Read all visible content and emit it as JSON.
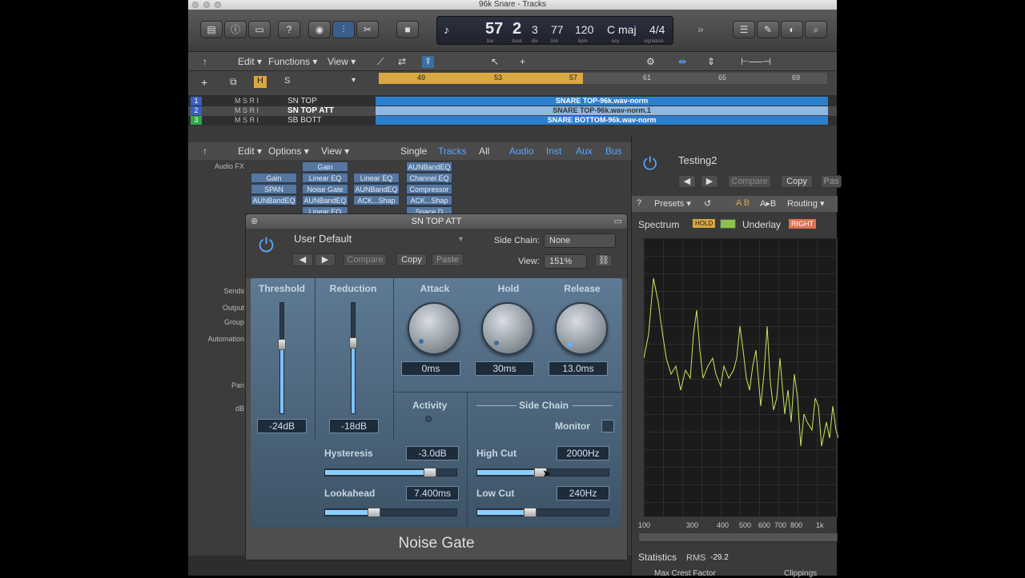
{
  "window": {
    "title": "96k Snare - Tracks"
  },
  "lcd": {
    "bar": "57",
    "beat": "2",
    "div": "3",
    "tick": "77",
    "tempo": "120",
    "key": "C maj",
    "signature": "4/4",
    "bar_label": "bar",
    "beat_label": "beat",
    "div_label": "div",
    "tick_label": "tick",
    "tempo_label": "bpm",
    "key_label": "key",
    "sig_label": "signature"
  },
  "toolbar_more": "»",
  "menubar": {
    "edit": "Edit ▾",
    "functions": "Functions ▾",
    "view": "View ▾"
  },
  "track_header": {
    "h_label": "H",
    "s_label": "S"
  },
  "ruler": {
    "marks": [
      "49",
      "53",
      "57",
      "61",
      "65",
      "69"
    ]
  },
  "tracks": [
    {
      "num": "1",
      "name": "SN TOP",
      "region": "SNARE TOP-96k.wav-norm"
    },
    {
      "num": "2",
      "name": "SN TOP ATT",
      "region": "SNARE TOP-96k.wav-norm.1"
    },
    {
      "num": "3",
      "name": "SB BOTT",
      "region": "SNARE BOTTOM-96k.wav-norm"
    }
  ],
  "mixer": {
    "edit": "Edit ▾",
    "options": "Options ▾",
    "view": "View ▾",
    "filters": {
      "single": "Single",
      "tracks": "Tracks",
      "all": "All",
      "audio": "Audio",
      "inst": "Inst",
      "aux": "Aux",
      "bus": "Bus"
    },
    "audio_fx_label": "Audio FX",
    "labels": {
      "sends": "Sends",
      "output": "Output",
      "group": "Group",
      "automation": "Automation",
      "pan": "Pan",
      "db": "dB"
    },
    "strip1": [
      "Gain",
      "SPAN",
      "AUNBandEQ"
    ],
    "strip2": [
      "Gain",
      "Linear EQ",
      "Noise Gate",
      "AUNBandEQ",
      "Linear EQ"
    ],
    "strip3": [
      "Linear EQ",
      "AUNBandEQ",
      "ACK...Shap"
    ],
    "strip4": [
      "AUNBandEQ",
      "Channel EQ",
      "Compressor",
      "ACK...Shap",
      "Space D"
    ]
  },
  "plugin": {
    "title": "SN TOP ATT",
    "preset": "User Default",
    "compare": "Compare",
    "copy": "Copy",
    "paste": "Paste",
    "side_chain_label": "Side Chain:",
    "side_chain_value": "None",
    "view_label": "View:",
    "view_value": "151%",
    "threshold": {
      "label": "Threshold",
      "value": "-24dB",
      "level": 0.62
    },
    "reduction": {
      "label": "Reduction",
      "value": "-18dB",
      "level": 0.64
    },
    "attack": {
      "label": "Attack",
      "value": "0ms"
    },
    "hold": {
      "label": "Hold",
      "value": "30ms"
    },
    "release": {
      "label": "Release",
      "value": "13.0ms"
    },
    "activity": "Activity",
    "side_chain_section": "Side Chain",
    "monitor": "Monitor",
    "hysteresis": {
      "label": "Hysteresis",
      "value": "-3.0dB",
      "level": 0.8
    },
    "lookahead": {
      "label": "Lookahead",
      "value": "7.400ms",
      "level": 0.37
    },
    "high_cut": {
      "label": "High Cut",
      "value": "2000Hz",
      "level": 0.48
    },
    "low_cut": {
      "label": "Low Cut",
      "value": "240Hz",
      "level": 0.4
    },
    "name": "Noise Gate"
  },
  "analyzer": {
    "title": "Testing2",
    "compare": "Compare",
    "copy": "Copy",
    "paste": "Pas",
    "presets": "Presets ▾",
    "routing": "Routing ▾",
    "spectrum": "Spectrum",
    "hold": "HOLD",
    "underlay": "Underlay",
    "right": "RIGHT",
    "freqs": [
      "100",
      "300",
      "400",
      "500",
      "600",
      "700",
      "800",
      "1k"
    ],
    "statistics": "Statistics",
    "rms_label": "RMS",
    "rms_value": "-29.2",
    "max_crest": "Max Crest Factor",
    "clippings": "Clippings"
  },
  "colors": {
    "accent": "#2a7fcf",
    "cycle": "#d9a840",
    "spectrum": "#c8e85a"
  }
}
